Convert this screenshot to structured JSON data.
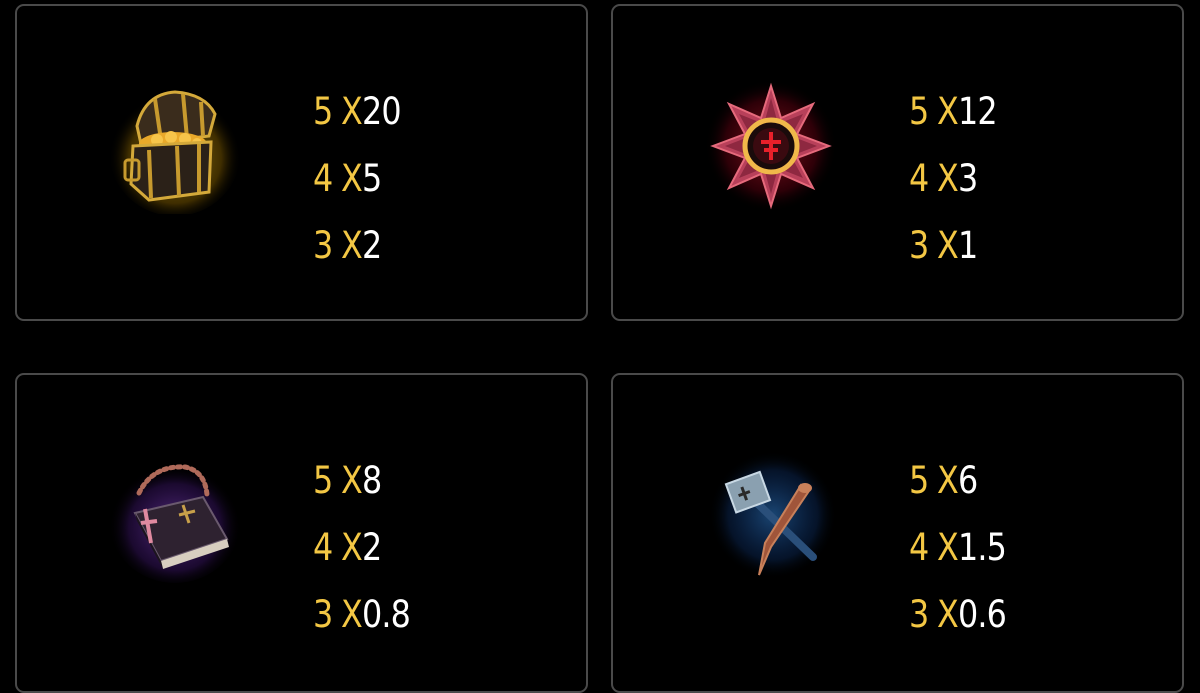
{
  "paytable": [
    {
      "symbol_icon": "treasure-chest-icon",
      "glow_color": "#ffcc33",
      "rows": [
        {
          "count": "5",
          "x": "X",
          "multiplier": "20"
        },
        {
          "count": "4",
          "x": "X",
          "multiplier": "5"
        },
        {
          "count": "3",
          "x": "X",
          "multiplier": "2"
        }
      ]
    },
    {
      "symbol_icon": "star-medal-icon",
      "glow_color": "#ff2a3a",
      "rows": [
        {
          "count": "5",
          "x": "X",
          "multiplier": "12"
        },
        {
          "count": "4",
          "x": "X",
          "multiplier": "3"
        },
        {
          "count": "3",
          "x": "X",
          "multiplier": "1"
        }
      ]
    },
    {
      "symbol_icon": "holy-book-rosary-icon",
      "glow_color": "#a64dff",
      "rows": [
        {
          "count": "5",
          "x": "X",
          "multiplier": "8"
        },
        {
          "count": "4",
          "x": "X",
          "multiplier": "2"
        },
        {
          "count": "3",
          "x": "X",
          "multiplier": "0.8"
        }
      ]
    },
    {
      "symbol_icon": "hammer-stake-icon",
      "glow_color": "#2f8cff",
      "rows": [
        {
          "count": "5",
          "x": "X",
          "multiplier": "6"
        },
        {
          "count": "4",
          "x": "X",
          "multiplier": "1.5"
        },
        {
          "count": "3",
          "x": "X",
          "multiplier": "0.6"
        }
      ]
    }
  ],
  "colors": {
    "background": "#000000",
    "panel_border": "#4a4a4a",
    "count_color": "#f3c744",
    "multiplier_color": "#ffffff"
  }
}
